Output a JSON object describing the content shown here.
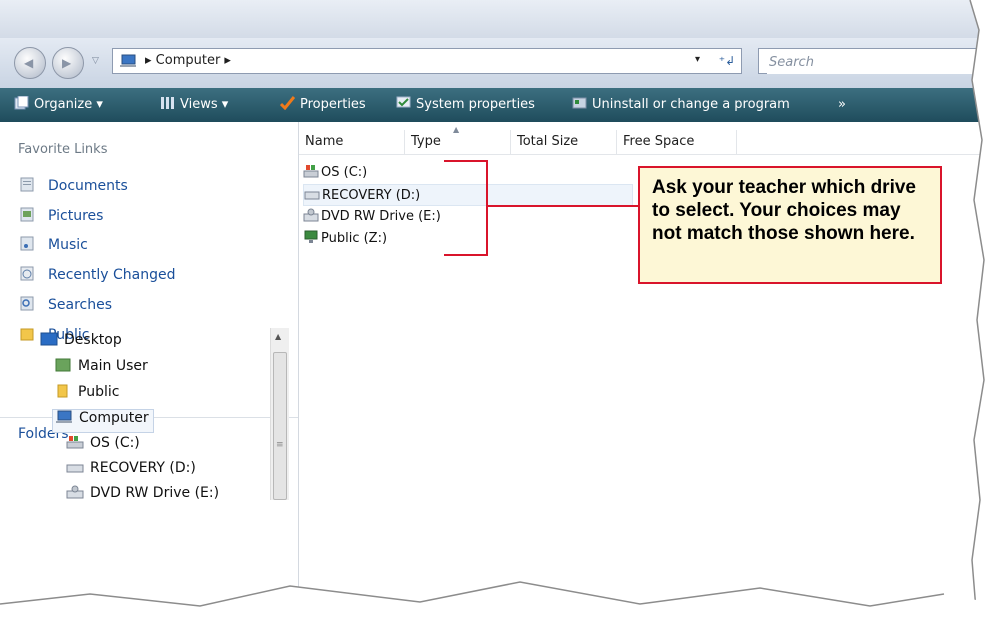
{
  "address": {
    "breadcrumb": "▸ Computer ▸",
    "dropdown_arrow": "▾",
    "refresh_glyph": "⁺↲"
  },
  "search": {
    "placeholder": "Search"
  },
  "toolbar": {
    "organize": "Organize ▾",
    "views": "Views ▾",
    "properties": "Properties",
    "system_properties": "System properties",
    "uninstall": "Uninstall or change a program",
    "more": "»"
  },
  "favorites": {
    "title": "Favorite Links",
    "items": [
      {
        "label": "Documents"
      },
      {
        "label": "Pictures"
      },
      {
        "label": "Music"
      },
      {
        "label": "Recently Changed"
      },
      {
        "label": "Searches"
      },
      {
        "label": "Public"
      }
    ]
  },
  "folders": {
    "title": "Folders",
    "tree": [
      {
        "label": "Desktop"
      },
      {
        "label": "Main User"
      },
      {
        "label": "Public"
      },
      {
        "label": "Computer"
      },
      {
        "label": "OS (C:)"
      },
      {
        "label": "RECOVERY (D:)"
      },
      {
        "label": "DVD RW Drive (E:)"
      }
    ]
  },
  "columns": [
    "Name",
    "Type",
    "Total Size",
    "Free Space"
  ],
  "drives": [
    {
      "label": "OS (C:)"
    },
    {
      "label": "RECOVERY (D:)"
    },
    {
      "label": "DVD RW Drive (E:)"
    },
    {
      "label": "Public (Z:)"
    }
  ],
  "callout": {
    "text": "Ask your teacher which drive to select. Your choices may not match those shown here."
  },
  "colors": {
    "accent_red": "#d9142b",
    "callout_bg": "#fdf7d6",
    "toolbar_bg": "#2b5d6e",
    "link_blue": "#1a4f9a"
  }
}
